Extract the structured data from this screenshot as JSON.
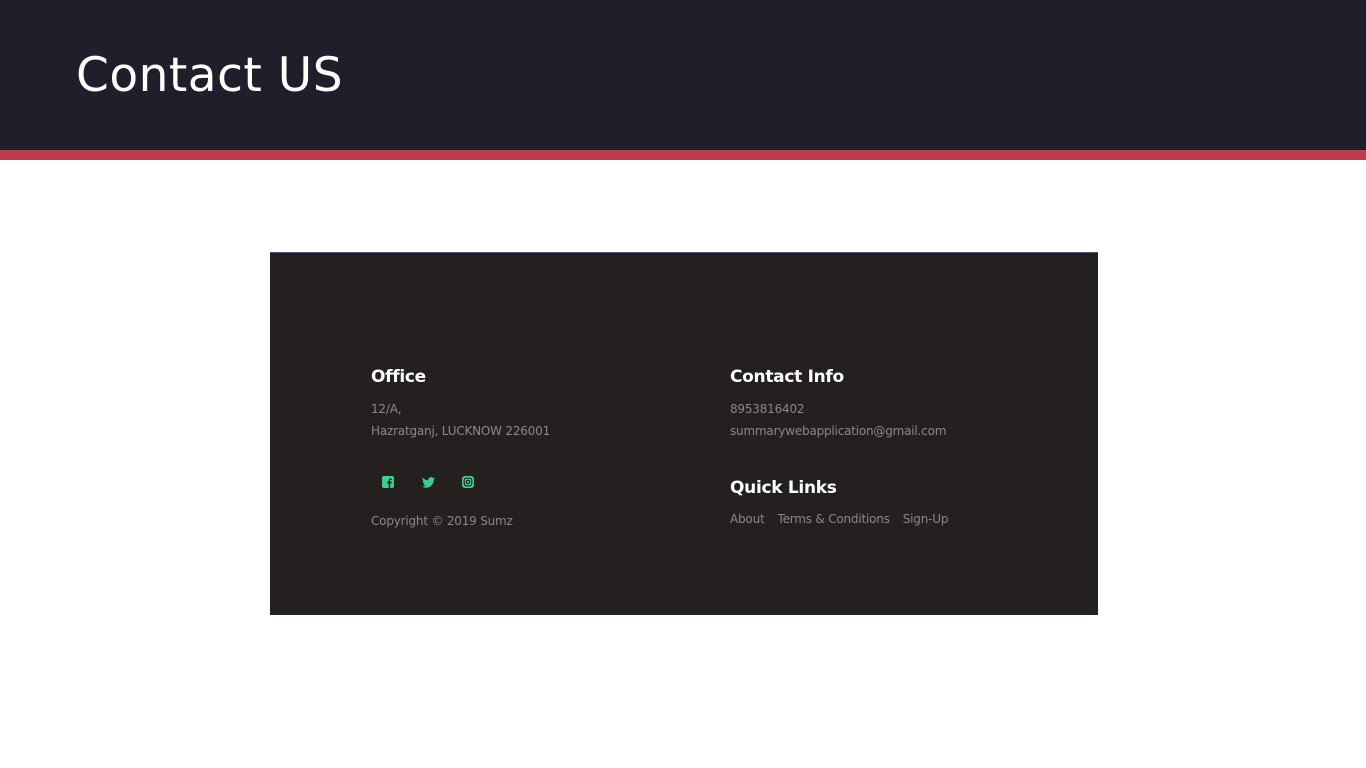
{
  "slide": {
    "title": "Contact US",
    "header_color": "#1f1f2b",
    "accent_color": "#c0394d"
  },
  "footer": {
    "background": "#242020",
    "office": {
      "heading": "Office",
      "address_line1": "12/A,",
      "address_line2": "Hazratganj, LUCKNOW 226001"
    },
    "social": {
      "icon_color": "#3ecf8e",
      "icons": [
        "facebook-icon",
        "twitter-icon",
        "instagram-icon"
      ]
    },
    "copyright": "Copyright © 2019 Sumz",
    "contact": {
      "heading": "Contact Info",
      "phone": "8953816402",
      "email": "summarywebapplication@gmail.com"
    },
    "quick_links": {
      "heading": "Quick Links",
      "items": [
        "About",
        "Terms & Conditions",
        "Sign-Up"
      ]
    }
  }
}
